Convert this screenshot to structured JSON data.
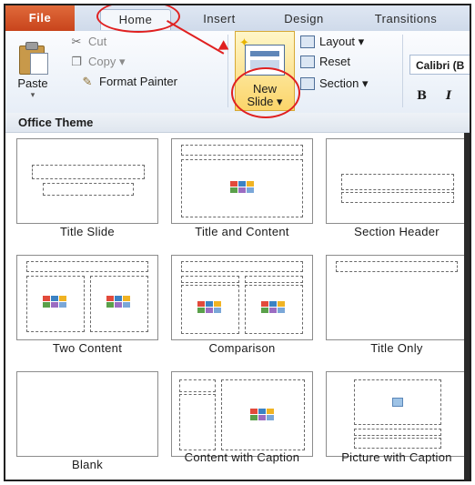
{
  "tabs": {
    "file": "File",
    "home": "Home",
    "insert": "Insert",
    "design": "Design",
    "transitions": "Transitions"
  },
  "ribbon": {
    "paste": "Paste",
    "cut": "Cut",
    "copy": "Copy",
    "copy_arrow": "▾",
    "format_painter": "Format Painter",
    "new_slide_line1": "New",
    "new_slide_line2": "Slide ▾",
    "layout": "Layout ▾",
    "reset": "Reset",
    "section": "Section ▾",
    "font_name": "Calibri (B",
    "bold": "B",
    "italic": "I"
  },
  "gallery": {
    "header": "Office Theme",
    "layouts": [
      {
        "label": "Title Slide"
      },
      {
        "label": "Title and Content"
      },
      {
        "label": "Section Header"
      },
      {
        "label": "Two Content"
      },
      {
        "label": "Comparison"
      },
      {
        "label": "Title Only"
      },
      {
        "label": "Blank"
      },
      {
        "label": "Content with Caption"
      },
      {
        "label": "Picture with Caption"
      }
    ]
  },
  "colors": {
    "file_tab": "#c8441c",
    "annotation": "#e02020",
    "new_slide_bg": "#fbd56a"
  }
}
